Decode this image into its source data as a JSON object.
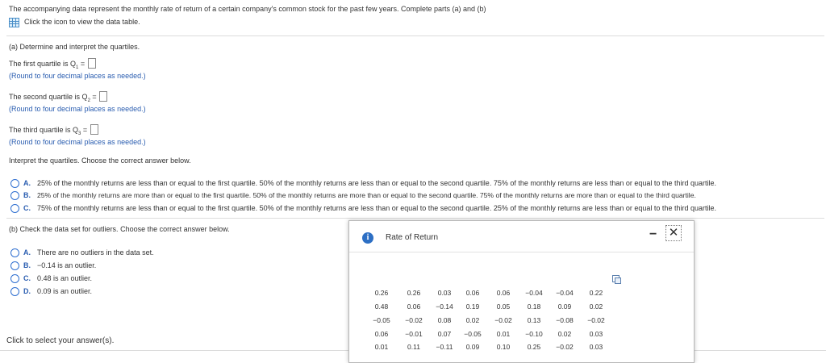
{
  "header": {
    "prompt": "The accompanying data represent the monthly rate of return of a certain company's common stock for the past few years. Complete parts (a) and (b)",
    "data_link": "Click the icon to view the data table."
  },
  "part_a": {
    "heading": "(a) Determine and interpret the quartiles.",
    "q1_label": "The first quartile is Q",
    "q1_sub": "1",
    "q2_label": "The second quartile is Q",
    "q2_sub": "2",
    "q3_label": "The third quartile is Q",
    "q3_sub": "3",
    "equals": " = ",
    "round_note": "(Round to four decimal places as needed.)",
    "interpret_prompt": "Interpret the quartiles. Choose the correct answer below.",
    "options": [
      {
        "letter": "A.",
        "text": "25% of the monthly returns are less than or equal to the first quartile. 50% of the monthly returns are less than or equal to the second quartile. 75% of the monthly returns are less than or equal to the third quartile."
      },
      {
        "letter": "B.",
        "text": "25% of the monthly returns are more than or equal to the first quartile. 50% of the monthly returns are more than or equal to the second quartile. 75% of the monthly returns are more than or equal to the third quartile."
      },
      {
        "letter": "C.",
        "text": "75% of the monthly returns are less than or equal to the first quartile. 50% of the monthly returns are less than or equal to the second quartile. 25% of the monthly returns are less than or equal to the third quartile."
      }
    ]
  },
  "part_b": {
    "heading": "(b) Check the data set for outliers. Choose the correct answer below.",
    "options": [
      {
        "letter": "A.",
        "text": "There are no outliers in the data set."
      },
      {
        "letter": "B.",
        "text": "−0.14 is an outlier."
      },
      {
        "letter": "C.",
        "text": "0.48 is an outlier."
      },
      {
        "letter": "D.",
        "text": "0.09 is an outlier."
      }
    ]
  },
  "footer": {
    "status": "Click to select your answer(s)."
  },
  "popup": {
    "title": "Rate of Return",
    "info_glyph": "i",
    "minimize_glyph": "−",
    "close_glyph": "✕",
    "rows": [
      [
        "0.26",
        "0.26",
        "0.03",
        "0.06",
        "0.06",
        "−0.04",
        "−0.04",
        "0.22"
      ],
      [
        "0.48",
        "0.06",
        "−0.14",
        "0.19",
        "0.05",
        "0.18",
        "0.09",
        "0.02"
      ],
      [
        "−0.05",
        "−0.02",
        "0.08",
        "0.02",
        "−0.02",
        "0.13",
        "−0.08",
        "−0.02"
      ],
      [
        "0.06",
        "−0.01",
        "0.07",
        "−0.05",
        "0.01",
        "−0.10",
        "0.02",
        "0.03"
      ],
      [
        "0.01",
        "0.11",
        "−0.11",
        "0.09",
        "0.10",
        "0.25",
        "−0.02",
        "0.03"
      ]
    ]
  },
  "colors": {
    "accent": "#2a5db0",
    "radio": "#2f6fd0",
    "info": "#2d6fc4"
  }
}
